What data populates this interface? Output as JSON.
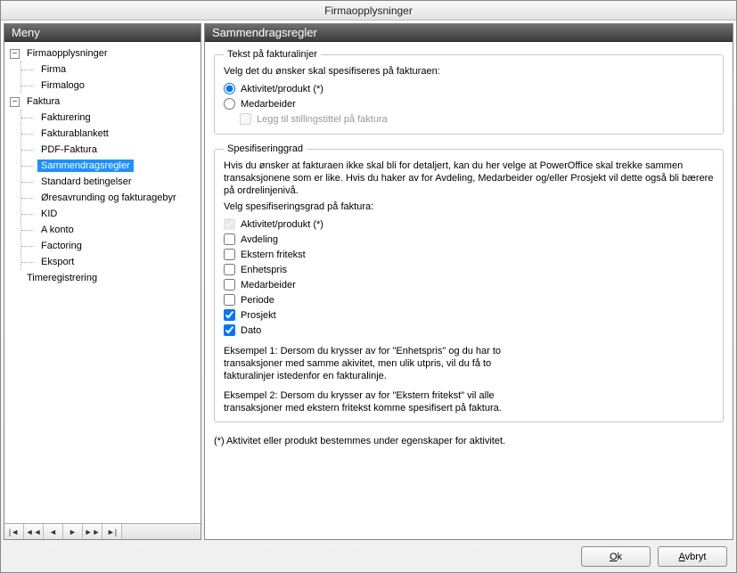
{
  "window": {
    "title": "Firmaopplysninger"
  },
  "left": {
    "header": "Meny",
    "tree": {
      "firmaopplysninger": {
        "label": "Firmaopplysninger",
        "expanded": true,
        "children": {
          "firma": "Firma",
          "firmalogo": "Firmalogo"
        }
      },
      "faktura": {
        "label": "Faktura",
        "expanded": true,
        "children": {
          "fakturering": "Fakturering",
          "fakturablankett": "Fakturablankett",
          "pdf_faktura": "PDF-Faktura",
          "sammendragsregler": "Sammendragsregler",
          "standard_betingelser": "Standard betingelser",
          "oresavrunding": "Øresavrunding og fakturagebyr",
          "kid": "KID",
          "a_konto": "A konto",
          "factoring": "Factoring",
          "eksport": "Eksport"
        }
      },
      "timeregistrering": {
        "label": "Timeregistrering"
      }
    },
    "selected": "sammendragsregler",
    "nav_glyphs": {
      "first": "|◄",
      "prev_page": "◄◄",
      "prev": "◄",
      "next": "►",
      "next_page": "►►",
      "last": "►|"
    }
  },
  "right": {
    "header": "Sammendragsregler",
    "group1": {
      "legend": "Tekst på fakturalinjer",
      "prompt": "Velg det du ønsker skal spesifiseres på fakturaen:",
      "radio_aktivitet": "Aktivitet/produkt (*)",
      "radio_medarbeider": "Medarbeider",
      "chk_stillingstittel": "Legg til stillingstittel på faktura",
      "selected_radio": "aktivitet"
    },
    "group2": {
      "legend": "Spesifiseringgrad",
      "intro": "Hvis du ønsker at fakturaen ikke skal bli for detaljert, kan du her velge at PowerOffice skal trekke sammen transaksjonene som er like. Hvis du haker av for Avdeling, Medarbeider og/eller Prosjekt vil dette også bli bærere på ordrelinjenivå.",
      "prompt": "Velg spesifiseringsgrad på faktura:",
      "checks": {
        "aktivitet": {
          "label": "Aktivitet/produkt (*)",
          "checked": true,
          "locked": true
        },
        "avdeling": {
          "label": "Avdeling",
          "checked": false
        },
        "ekstern_fritekst": {
          "label": "Ekstern fritekst",
          "checked": false
        },
        "enhetspris": {
          "label": "Enhetspris",
          "checked": false
        },
        "medarbeider": {
          "label": "Medarbeider",
          "checked": false
        },
        "periode": {
          "label": "Periode",
          "checked": false
        },
        "prosjekt": {
          "label": "Prosjekt",
          "checked": true
        },
        "dato": {
          "label": "Dato",
          "checked": true
        }
      },
      "example1": "Eksempel 1: Dersom du krysser av for \"Enhetspris\" og du har to transaksjoner med samme akivitet, men ulik utpris, vil du få to fakturalinjer istedenfor en fakturalinje.",
      "example2": "Eksempel 2: Dersom du krysser av for \"Ekstern fritekst\" vil alle transaksjoner med ekstern fritekst komme spesifisert på faktura."
    },
    "footnote": "(*) Aktivitet eller produkt bestemmes under egenskaper for aktivitet."
  },
  "buttons": {
    "ok": "Ok",
    "cancel": "Avbryt"
  }
}
